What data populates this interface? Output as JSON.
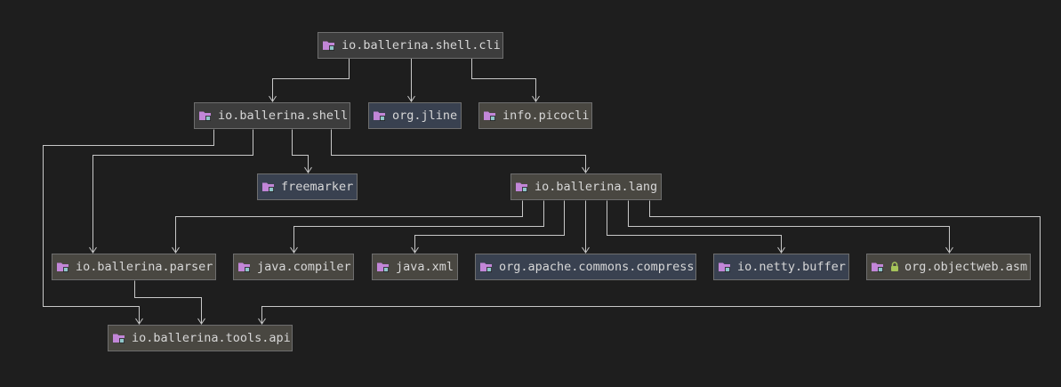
{
  "colors": {
    "background": "#1e1e1e",
    "edge": "#c8c8c8",
    "module_gray": "#3d3d3d",
    "module_olive": "#494741",
    "module_blue": "#394150",
    "folder_icon": "#c286d8",
    "folder_badge": "#8fc5c8",
    "lock_icon": "#a6c45a"
  },
  "nodes": [
    {
      "id": "shell_cli",
      "label": "io.ballerina.shell.cli",
      "icon": "module-folder-icon"
    },
    {
      "id": "shell",
      "label": "io.ballerina.shell",
      "icon": "module-folder-icon"
    },
    {
      "id": "jline",
      "label": "org.jline",
      "icon": "module-folder-icon"
    },
    {
      "id": "picocli",
      "label": "info.picocli",
      "icon": "module-folder-icon"
    },
    {
      "id": "freemarker",
      "label": "freemarker",
      "icon": "module-folder-icon"
    },
    {
      "id": "lang",
      "label": "io.ballerina.lang",
      "icon": "module-folder-icon"
    },
    {
      "id": "parser",
      "label": "io.ballerina.parser",
      "icon": "module-folder-icon"
    },
    {
      "id": "compiler",
      "label": "java.compiler",
      "icon": "module-folder-icon"
    },
    {
      "id": "xml",
      "label": "java.xml",
      "icon": "module-folder-icon"
    },
    {
      "id": "compress",
      "label": "org.apache.commons.compress",
      "icon": "module-folder-icon"
    },
    {
      "id": "netty",
      "label": "io.netty.buffer",
      "icon": "module-folder-icon"
    },
    {
      "id": "asm",
      "label": "org.objectweb.asm",
      "icon": "module-folder-icon",
      "locked": true
    },
    {
      "id": "tools_api",
      "label": "io.ballerina.tools.api",
      "icon": "module-folder-icon"
    }
  ],
  "edges": [
    {
      "from": "shell_cli",
      "to": "shell"
    },
    {
      "from": "shell_cli",
      "to": "jline"
    },
    {
      "from": "shell_cli",
      "to": "picocli"
    },
    {
      "from": "shell",
      "to": "tools_api"
    },
    {
      "from": "shell",
      "to": "parser"
    },
    {
      "from": "shell",
      "to": "freemarker"
    },
    {
      "from": "shell",
      "to": "lang"
    },
    {
      "from": "lang",
      "to": "parser"
    },
    {
      "from": "lang",
      "to": "compiler"
    },
    {
      "from": "lang",
      "to": "xml"
    },
    {
      "from": "lang",
      "to": "compress"
    },
    {
      "from": "lang",
      "to": "netty"
    },
    {
      "from": "lang",
      "to": "asm"
    },
    {
      "from": "lang",
      "to": "tools_api"
    },
    {
      "from": "parser",
      "to": "tools_api"
    }
  ]
}
